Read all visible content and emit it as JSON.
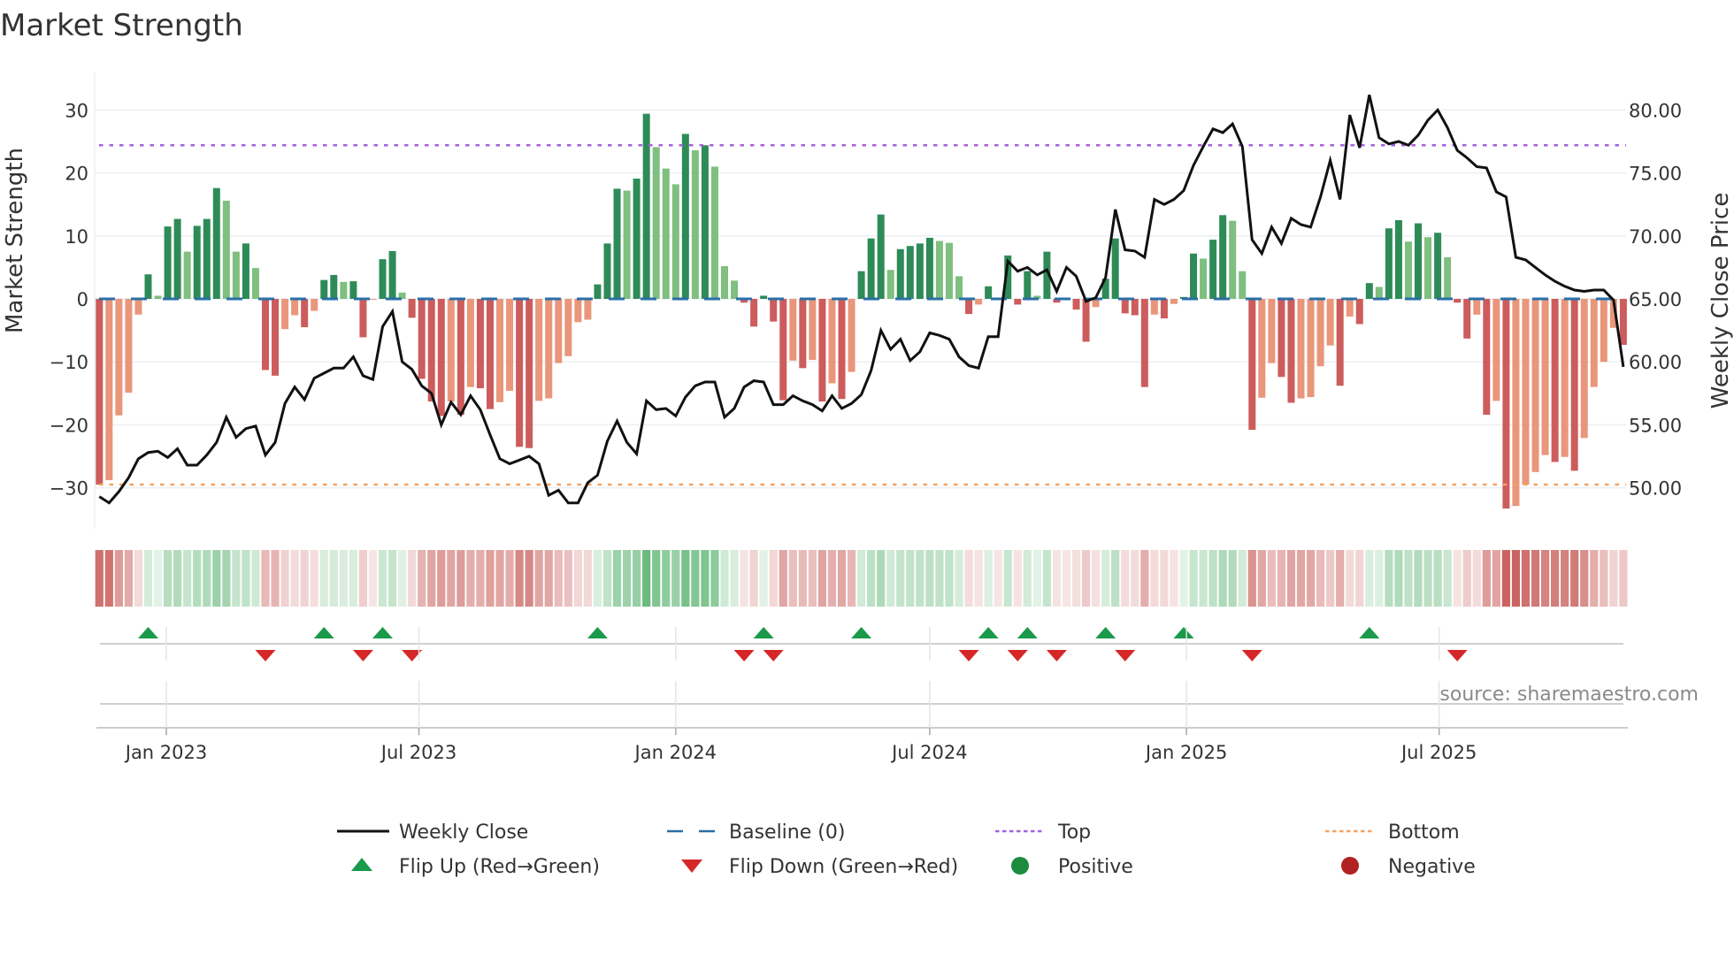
{
  "title": "Market Strength",
  "source": "source: sharemaestro.com",
  "colors": {
    "pos_strong": "#2e8b57",
    "pos_weak": "#7fbf7f",
    "neg_strong": "#cd5c5c",
    "neg_weak": "#e9967a",
    "baseline": "#2a6fa8",
    "top": "#a461e0",
    "bottom": "#f4a261",
    "close": "#111111",
    "flip_up": "#1a9a4a",
    "flip_down": "#d62728",
    "positive": "#1e8c3e",
    "negative": "#b22222"
  },
  "chart_data": {
    "type": "bar",
    "title": "Market Strength",
    "ylabel": "Market Strength",
    "y2label": "Weekly Close Price",
    "ylim": [
      -36.5,
      36.1
    ],
    "y2lim": [
      46.75,
      83.05
    ],
    "yticks": [
      "30",
      "20",
      "10",
      "0",
      "−10",
      "−20",
      "−30"
    ],
    "ytick_values": [
      30,
      20,
      10,
      0,
      -10,
      -20,
      -30
    ],
    "y2ticks": [
      "80.00",
      "75.00",
      "70.00",
      "65.00",
      "60.00",
      "55.00",
      "50.00"
    ],
    "y2tick_values": [
      80,
      75,
      70,
      65,
      60,
      55,
      50
    ],
    "xticks": [
      {
        "label": "Jan 2023",
        "date": "2023-01-01"
      },
      {
        "label": "Jul 2023",
        "date": "2023-07-01"
      },
      {
        "label": "Jan 2024",
        "date": "2024-01-01"
      },
      {
        "label": "Jul 2024",
        "date": "2024-07-01"
      },
      {
        "label": "Jan 2025",
        "date": "2025-01-01"
      },
      {
        "label": "Jul 2025",
        "date": "2025-07-01"
      }
    ],
    "x_start": "2022-11-14",
    "x_step_days": 7,
    "top_level": 24.4,
    "bottom_level": -29.5,
    "baseline": 0,
    "strength": [
      -29.5,
      -28.8,
      -18.5,
      -14.9,
      -2.5,
      3.9,
      0.5,
      11.5,
      12.7,
      7.5,
      11.6,
      12.7,
      17.6,
      15.6,
      7.5,
      8.8,
      4.9,
      -11.3,
      -12.2,
      -4.8,
      -2.6,
      -4.5,
      -1.9,
      3.0,
      3.8,
      2.7,
      2.8,
      -6.1,
      -0.1,
      6.3,
      7.6,
      1.0,
      -3.0,
      -12.7,
      -16.3,
      -18.6,
      -16.3,
      -18.4,
      -14.0,
      -14.2,
      -17.5,
      -16.4,
      -14.6,
      -23.5,
      -23.7,
      -16.2,
      -15.8,
      -10.2,
      -9.1,
      -3.7,
      -3.3,
      2.3,
      8.8,
      17.5,
      17.2,
      19.1,
      29.4,
      24.1,
      20.7,
      18.2,
      26.2,
      23.6,
      24.4,
      21.0,
      5.2,
      2.9,
      -0.6,
      -4.4,
      0.5,
      -3.6,
      -16.1,
      -9.8,
      -11.0,
      -9.7,
      -16.3,
      -13.4,
      -15.9,
      -11.6,
      4.4,
      9.6,
      13.4,
      4.6,
      7.9,
      8.4,
      8.8,
      9.7,
      9.2,
      8.9,
      3.6,
      -2.4,
      -0.9,
      2.0,
      0,
      6.9,
      -0.9,
      4.4,
      0.5,
      7.5,
      -0.6,
      0,
      -1.7,
      -6.8,
      -1.3,
      3.2,
      9.6,
      -2.3,
      -2.6,
      -14.0,
      -2.5,
      -3.1,
      -0.8,
      0.3,
      7.2,
      6.4,
      9.4,
      13.3,
      12.4,
      4.4,
      -20.8,
      -15.7,
      -10.2,
      -12.4,
      -16.5,
      -15.8,
      -15.6,
      -10.7,
      -7.4,
      -13.8,
      -2.8,
      -4.0,
      2.5,
      1.9,
      11.2,
      12.5,
      9.1,
      12.0,
      9.8,
      10.5,
      6.6,
      -0.6,
      -6.3,
      -2.5,
      -18.4,
      -16.2,
      -33.3,
      -32.9,
      -29.5,
      -27.5,
      -24.8,
      -25.9,
      -25.1,
      -27.3,
      -22.1,
      -14.0,
      -10.0,
      -4.6,
      -7.3
    ],
    "weekly_close": [
      49.3,
      48.8,
      49.7,
      50.8,
      52.3,
      52.8,
      52.9,
      52.4,
      53.1,
      51.8,
      51.8,
      52.6,
      53.6,
      55.6,
      54.0,
      54.7,
      54.9,
      52.6,
      53.6,
      56.7,
      58.0,
      57.0,
      58.7,
      59.1,
      59.5,
      59.5,
      60.4,
      58.9,
      58.6,
      62.8,
      64.0,
      60.0,
      59.4,
      58.1,
      57.5,
      55.0,
      56.8,
      55.8,
      57.3,
      56.2,
      54.2,
      52.3,
      51.9,
      52.2,
      52.5,
      51.9,
      49.4,
      49.8,
      48.8,
      48.8,
      50.4,
      51.0,
      53.7,
      55.3,
      53.6,
      52.7,
      56.9,
      56.2,
      56.3,
      55.7,
      57.2,
      58.1,
      58.4,
      58.4,
      55.6,
      56.3,
      58.0,
      58.5,
      58.4,
      56.6,
      56.6,
      57.3,
      56.9,
      56.6,
      56.1,
      57.3,
      56.3,
      56.7,
      57.4,
      59.3,
      62.5,
      61.0,
      61.8,
      60.1,
      60.8,
      62.3,
      62.1,
      61.8,
      60.4,
      59.7,
      59.5,
      62.0,
      62.0,
      68.0,
      67.2,
      67.5,
      66.9,
      67.3,
      65.6,
      67.5,
      66.8,
      64.8,
      65.1,
      66.7,
      72.1,
      68.9,
      68.8,
      68.3,
      72.9,
      72.5,
      72.9,
      73.6,
      75.6,
      77.1,
      78.5,
      78.2,
      78.9,
      77.1,
      69.7,
      68.6,
      70.7,
      69.4,
      71.4,
      70.9,
      70.7,
      73.1,
      76.0,
      72.9,
      79.6,
      77.0,
      81.2,
      77.8,
      77.3,
      77.5,
      77.2,
      78.0,
      79.2,
      80.0,
      78.6,
      76.8,
      76.2,
      75.5,
      75.4,
      73.5,
      73.1,
      68.3,
      68.1,
      67.5,
      66.9,
      66.4,
      66.0,
      65.7,
      65.6,
      65.7,
      65.7,
      64.9,
      59.6
    ],
    "legend_position": "bottom",
    "legend": [
      {
        "label": "Weekly Close",
        "kind": "line"
      },
      {
        "label": "Baseline (0)",
        "kind": "dashed"
      },
      {
        "label": "Top",
        "kind": "dotted-top"
      },
      {
        "label": "Bottom",
        "kind": "dotted-bottom"
      },
      {
        "label": "Flip Up (Red→Green)",
        "kind": "tri-up"
      },
      {
        "label": "Flip Down (Green→Red)",
        "kind": "tri-down"
      },
      {
        "label": "Positive",
        "kind": "dot-pos"
      },
      {
        "label": "Negative",
        "kind": "dot-neg"
      }
    ]
  }
}
